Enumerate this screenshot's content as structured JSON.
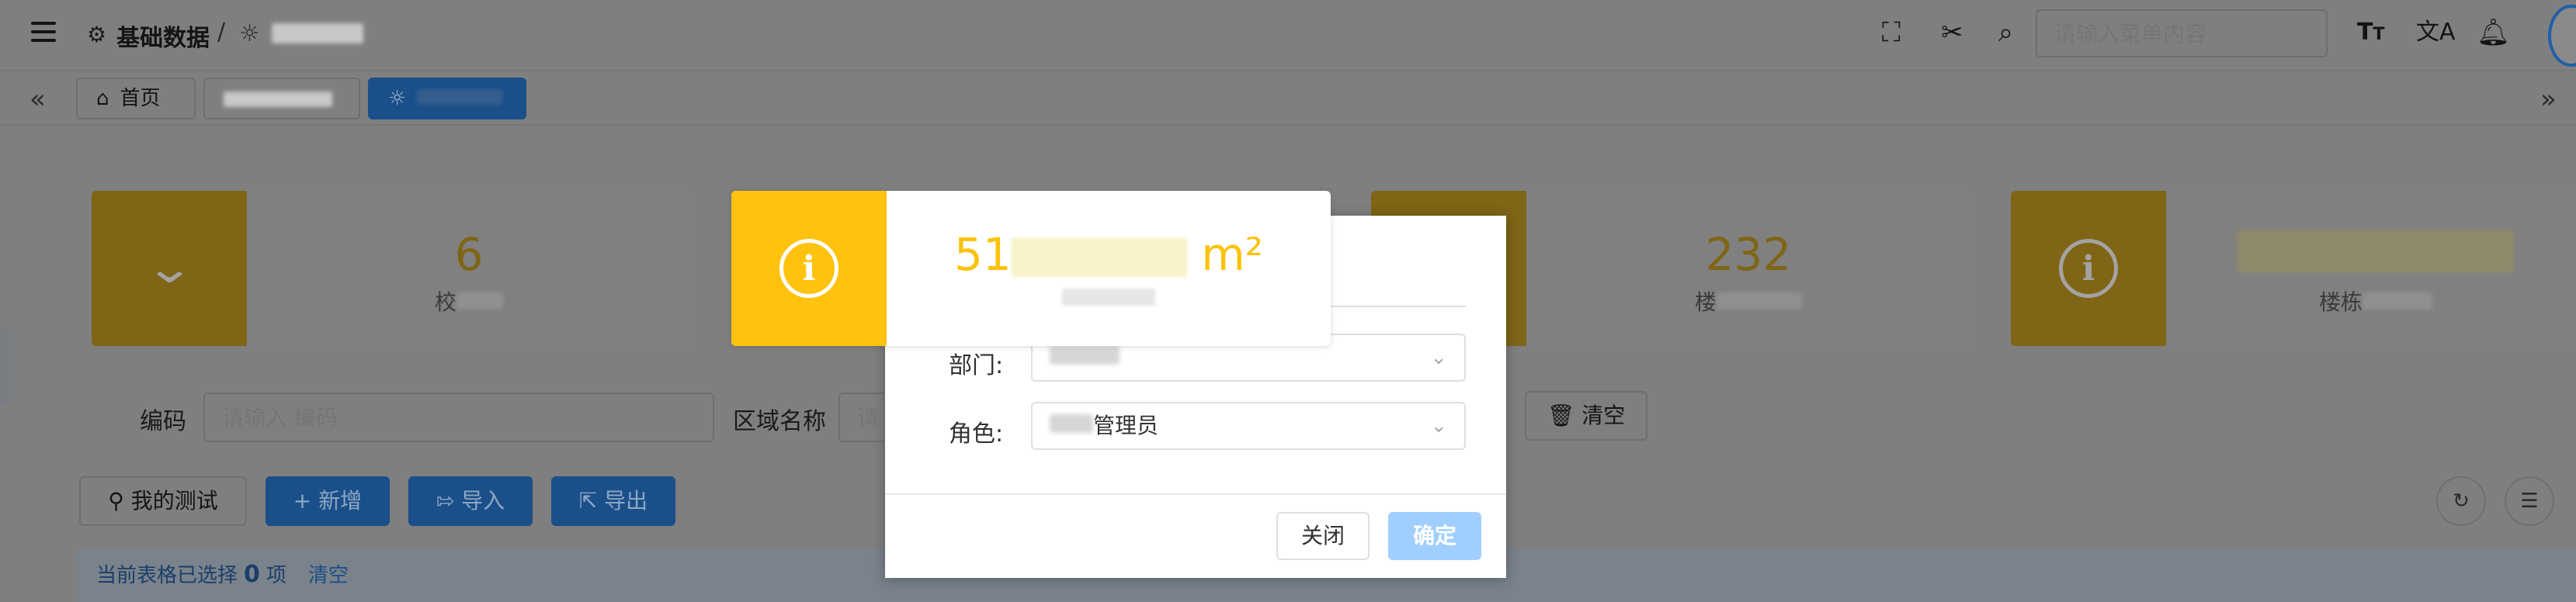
{
  "header": {
    "breadcrumb_root": "基础数据",
    "breadcrumb_sep": "/",
    "search_placeholder": "请输入菜单内容"
  },
  "tabs": {
    "home": "首页"
  },
  "stats": [
    {
      "value": "6",
      "label": "校"
    },
    {
      "value": "51",
      "unit": "m²",
      "label": ""
    },
    {
      "value": "232",
      "label": "楼"
    },
    {
      "value": "",
      "label": "楼栋"
    }
  ],
  "form": {
    "code_label": "编码",
    "code_placeholder": "请输入 编码",
    "area_label": "区域名称",
    "area_placeholder": "请",
    "clear_button": "清空"
  },
  "actions": {
    "my_test": "我的测试",
    "add": "新增",
    "import": "导入",
    "export": "导出"
  },
  "selection": {
    "prefix": "当前表格已选择",
    "count": "0",
    "suffix": "项",
    "clear": "清空"
  },
  "dialog": {
    "dept_label": "部门:",
    "role_label": "角色:",
    "role_value": "管理员",
    "close_button": "关闭",
    "confirm_button": "确定"
  },
  "colors": {
    "accent_yellow": "#ffc20e",
    "primary_blue": "#409eff",
    "confirm_disabled": "#a0cfff"
  }
}
